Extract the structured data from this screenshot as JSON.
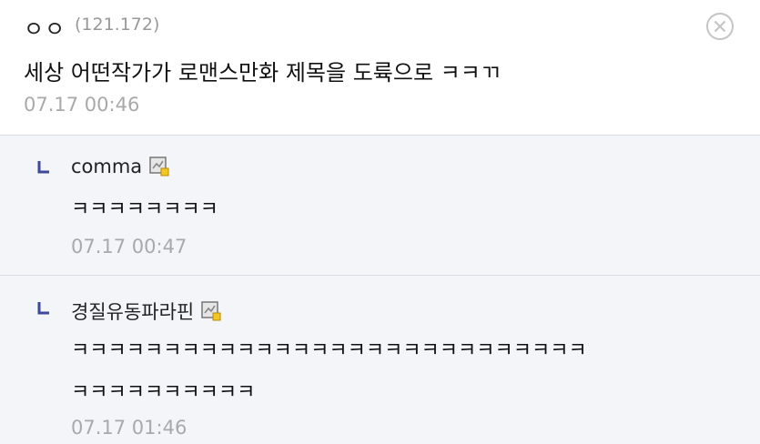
{
  "main_comment": {
    "author": "ㅇㅇ",
    "ip": "(121.172)",
    "text": "세상 어떤작가가 로맨스만화 제목을 도륙으로 ㅋㅋㄲ",
    "timestamp": "07.17 00:46",
    "close_icon": "close-circle-icon"
  },
  "replies": [
    {
      "author": "comma",
      "member_icon": "member-badge-icon",
      "text": "ㅋㅋㅋㅋㅋㅋㅋㅋ",
      "timestamp": "07.17 00:47"
    },
    {
      "author": "경질유동파라핀",
      "member_icon": "member-badge-icon",
      "text_line1": "ㅋㅋㅋㅋㅋㅋㅋㅋㅋㅋㅋㅋㅋㅋㅋㅋㅋㅋㅋㅋㅋㅋㅋㅋㅋㅋㅋㅋ",
      "text_line2": "ㅋㅋㅋㅋㅋㅋㅋㅋㅋㅋ",
      "timestamp": "07.17 01:46"
    }
  ],
  "colors": {
    "reply_background": "#f4f5f9",
    "divider": "#d9dde6",
    "reply_arrow": "#3b4a9a",
    "timestamp": "#a9a9a9"
  }
}
